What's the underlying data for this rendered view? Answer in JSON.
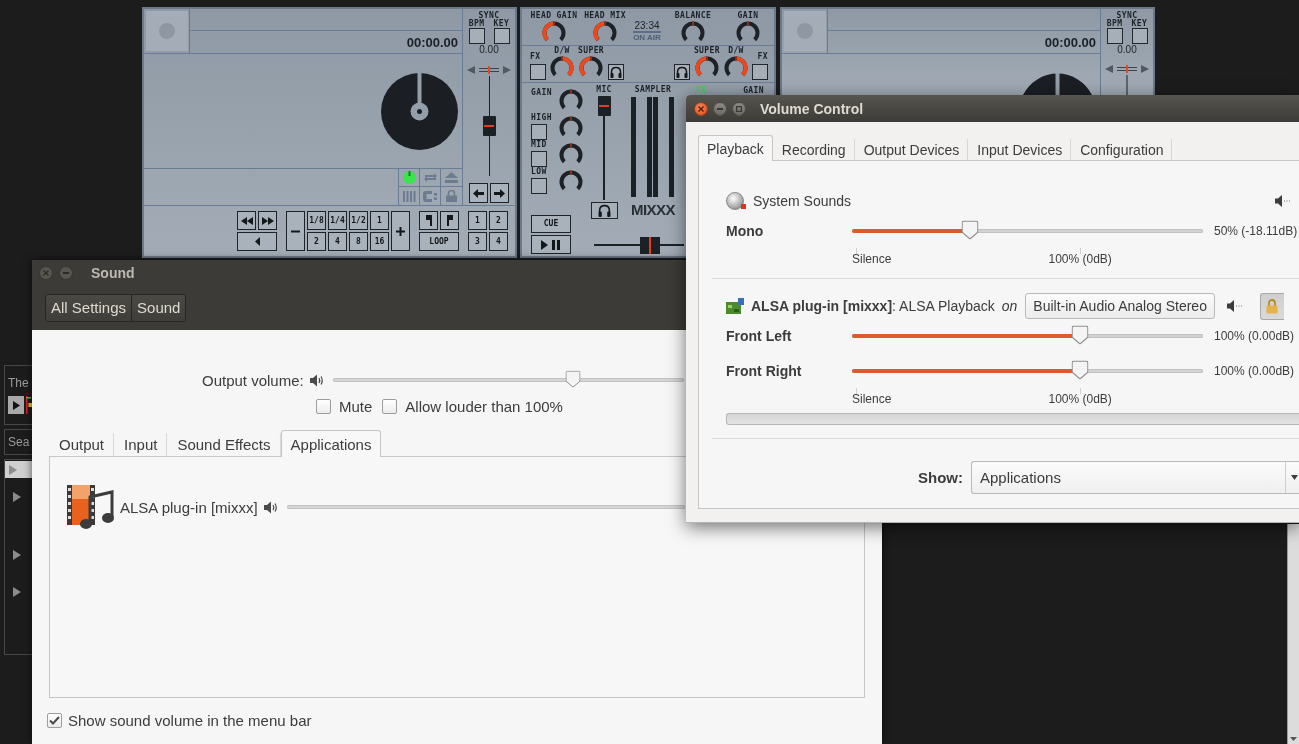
{
  "mixxx": {
    "decks": [
      {
        "time": "00:00.00",
        "sync": "SYNC",
        "bpm": "BPM",
        "key": "KEY",
        "rate": "0.00",
        "pitch": {
          "level": 0.5
        },
        "transport": {
          "loop_sizes": [
            "1/8",
            "1/4",
            "1/2",
            "1",
            "2",
            "4",
            "8",
            "16"
          ],
          "loop": "LOOP",
          "hotcues": [
            "1",
            "2",
            "3",
            "4"
          ]
        }
      },
      {
        "time": "00:00.00",
        "sync": "SYNC",
        "bpm": "BPM",
        "key": "KEY",
        "rate": "0.00"
      }
    ],
    "mixer": {
      "top_knobs": [
        {
          "label": "HEAD GAIN",
          "kind": "left"
        },
        {
          "label": "HEAD MIX",
          "kind": "left"
        },
        {
          "label": "BALANCE",
          "kind": "plain"
        },
        {
          "label": "GAIN",
          "kind": "plain"
        }
      ],
      "clock": {
        "time": "23:34",
        "on_air": "ON AIR"
      },
      "effect_units": [
        {
          "fx": "FX",
          "knobs": [
            {
              "label": "D/W",
              "kind": "right"
            },
            {
              "label": "SUPER",
              "kind": "left"
            }
          ]
        },
        {
          "fx": "FX",
          "knobs": [
            {
              "label": "SUPER",
              "kind": "left"
            },
            {
              "label": "D/W",
              "kind": "right"
            }
          ]
        }
      ],
      "eq": [
        {
          "label": "GAIN",
          "kind": "plain"
        },
        {
          "label": "HIGH",
          "kind": "plain",
          "kill": false
        },
        {
          "label": "MID",
          "kind": "plain",
          "kill": false
        },
        {
          "label": "LOW",
          "kind": "plain",
          "kill": false
        }
      ],
      "mic": {
        "label": "MIC",
        "level": 1
      },
      "sampler": {
        "label": "SAMPLER"
      },
      "fx_label": "FX",
      "gain_label": "GAIN",
      "logo": "MIXXX",
      "cue": "CUE",
      "crossfader": {
        "level": 0.6
      }
    },
    "library": {
      "track": "The",
      "search": {
        "placeholder": "Sea"
      }
    }
  },
  "sound": {
    "title": "Sound",
    "breadcrumbs": [
      {
        "label": "All Settings"
      },
      {
        "label": "Sound"
      }
    ],
    "output_volume": {
      "label": "Output volume:",
      "level": 0.684
    },
    "options": [
      {
        "label": "Mute",
        "checked": false
      },
      {
        "label": "Allow louder than 100%",
        "checked": false
      }
    ],
    "tabs": [
      {
        "label": "Output",
        "selected": false
      },
      {
        "label": "Input",
        "selected": false
      },
      {
        "label": "Sound Effects",
        "selected": false
      },
      {
        "label": "Applications",
        "selected": true
      }
    ],
    "applications": [
      {
        "name": "ALSA plug-in [mixxx]"
      }
    ],
    "menu_bar_option": {
      "label": "Show sound volume in the menu bar",
      "checked": true
    }
  },
  "volume_control": {
    "title": "Volume Control",
    "tabs": [
      {
        "label": "Playback",
        "selected": true
      },
      {
        "label": "Recording",
        "selected": false
      },
      {
        "label": "Output Devices",
        "selected": false
      },
      {
        "label": "Input Devices",
        "selected": false
      },
      {
        "label": "Configuration",
        "selected": false
      }
    ],
    "streams": [
      {
        "kind": "system",
        "name": "System Sounds",
        "muted": false,
        "channels": [
          {
            "name": "Mono",
            "level": 0.335,
            "reading": "50% (-18.11dB)"
          }
        ],
        "scale": [
          "Silence",
          "100% (0dB)"
        ]
      },
      {
        "kind": "application",
        "name": "**ALSA plug-in [mixxx]**: ALSA Playback",
        "connector": "on",
        "device": "Built-in Audio Analog Stereo",
        "muted": false,
        "locked": true,
        "channels": [
          {
            "name": "Front Left",
            "level": 0.65,
            "reading": "100% (0.00dB)"
          },
          {
            "name": "Front Right",
            "level": 0.65,
            "reading": "100% (0.00dB)"
          }
        ],
        "scale": [
          "Silence",
          "100% (0dB)"
        ]
      }
    ],
    "show": {
      "label": "Show:",
      "value": "Applications"
    }
  }
}
